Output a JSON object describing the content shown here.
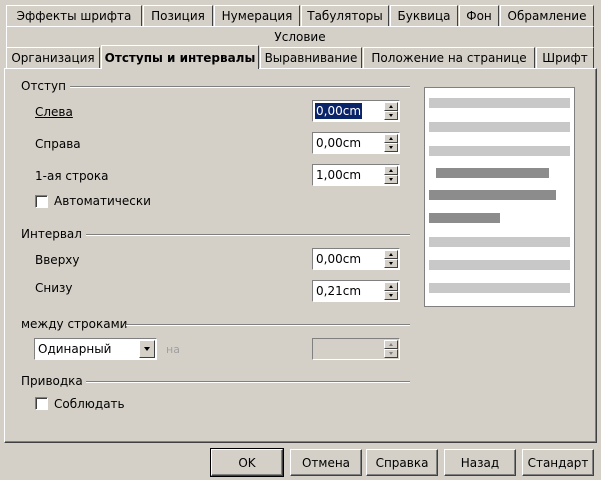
{
  "tabs_row1": [
    "Эффекты шрифта",
    "Позиция",
    "Нумерация",
    "Табуляторы",
    "Буквица",
    "Фон",
    "Обрамление"
  ],
  "tab_condition": "Условие",
  "tabs_row3": [
    "Организация",
    "Отступы и интервалы",
    "Выравнивание",
    "Положение на странице",
    "Шрифт"
  ],
  "active_tab": "Отступы и интервалы",
  "indent": {
    "title": "Отступ",
    "left_label": "Слева",
    "left_value": "0,00cm",
    "right_label": "Справа",
    "right_value": "0,00cm",
    "first_line_label": "1-ая строка",
    "first_line_value": "1,00cm",
    "auto_label": "Автоматически",
    "auto_checked": false
  },
  "spacing": {
    "title": "Интервал",
    "above_label": "Вверху",
    "above_value": "0,00cm",
    "below_label": "Снизу",
    "below_value": "0,21cm"
  },
  "line_spacing": {
    "title": "между строками",
    "selected": "Одинарный",
    "of_label": "на",
    "of_value": ""
  },
  "register": {
    "title": "Приводка",
    "activate_label": "Соблюдать",
    "activate_checked": false
  },
  "buttons": {
    "ok": "OK",
    "cancel": "Отмена",
    "help": "Справка",
    "back": "Назад",
    "reset": "Стандарт"
  },
  "colors": {
    "dialog_bg": "#d4d0c8",
    "selection": "#0a246a",
    "preview_light": "#c8c8c8",
    "preview_dark": "#8c8c8c"
  }
}
